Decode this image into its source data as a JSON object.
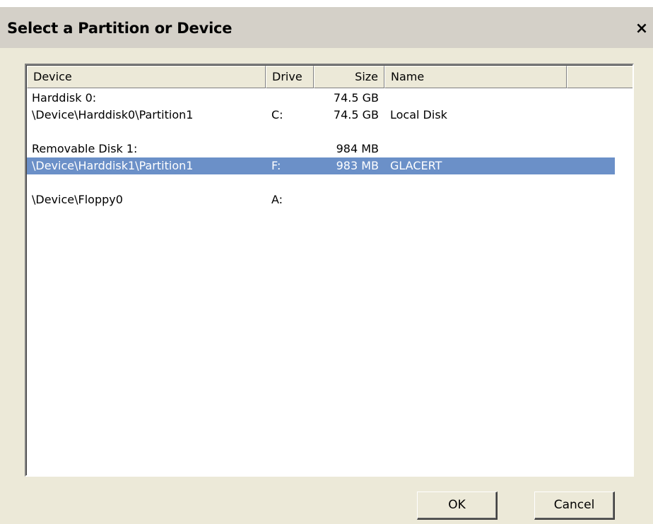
{
  "window": {
    "title": "Select a Partition or Device",
    "close_label": "×"
  },
  "columns": {
    "device": "Device",
    "drive": "Drive",
    "size": "Size",
    "name": "Name"
  },
  "rows": [
    {
      "device": "Harddisk 0:",
      "drive": "",
      "size": "74.5 GB",
      "name": "",
      "selected": false
    },
    {
      "device": "\\Device\\Harddisk0\\Partition1",
      "drive": "C:",
      "size": "74.5 GB",
      "name": "Local Disk",
      "selected": false
    },
    {
      "device": "",
      "drive": "",
      "size": "",
      "name": "",
      "selected": false
    },
    {
      "device": "Removable Disk 1:",
      "drive": "",
      "size": "984 MB",
      "name": "",
      "selected": false
    },
    {
      "device": "\\Device\\Harddisk1\\Partition1",
      "drive": "F:",
      "size": "983 MB",
      "name": "GLACERT",
      "selected": true
    },
    {
      "device": "",
      "drive": "",
      "size": "",
      "name": "",
      "selected": false
    },
    {
      "device": "\\Device\\Floppy0",
      "drive": "A:",
      "size": "",
      "name": "",
      "selected": false
    }
  ],
  "buttons": {
    "ok": "OK",
    "cancel": "Cancel"
  },
  "colors": {
    "dialog_bg": "#ece9d8",
    "titlebar_bg": "#d4d0c8",
    "selection": "#6b90c8"
  },
  "icons": {
    "close": "close-icon"
  }
}
